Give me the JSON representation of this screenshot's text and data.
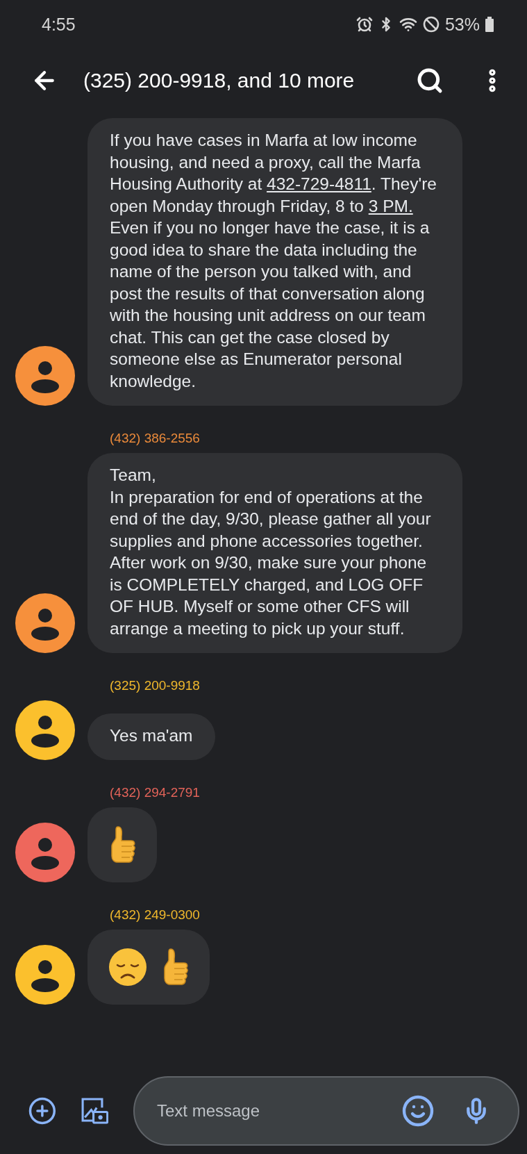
{
  "status_bar": {
    "time": "4:55",
    "battery": "53%"
  },
  "header": {
    "title": "(325) 200-9918, and 10 more"
  },
  "messages": [
    {
      "kind": "text",
      "color": "#f6903c",
      "parts": [
        {
          "text": "If you have cases in Marfa at low income housing, and need a proxy, call the Marfa Housing Authority at ",
          "link": false
        },
        {
          "text": "432-729-4811",
          "link": true
        },
        {
          "text": ". They're open Monday through Friday, 8 to ",
          "link": false
        },
        {
          "text": "3 PM.",
          "link": true
        },
        {
          "text": " Even if you no longer have the case, it is a good idea to share the data including the name of the person you talked with, and post the results of that conversation along with the housing unit address on our team chat. This can get the case closed by someone else as Enumerator personal knowledge.",
          "link": false
        }
      ]
    },
    {
      "kind": "text",
      "sender": "(432) 386-2556",
      "color": "#f6903c",
      "parts": [
        {
          "text": "Team,\nIn preparation for end of operations at the end of the day, 9/30, please gather all your supplies and phone accessories together. After work on 9/30, make sure your phone is COMPLETELY charged, and LOG OFF OF HUB. Myself or some other CFS will arrange a meeting to pick up your stuff.",
          "link": false
        }
      ]
    },
    {
      "kind": "text",
      "sender": "(325) 200-9918",
      "color": "#fbc02d",
      "parts": [
        {
          "text": "Yes ma'am",
          "link": false
        }
      ]
    },
    {
      "kind": "emoji",
      "sender": "(432) 294-2791",
      "color": "#ee675c",
      "emojis": [
        {
          "kind": "thumbs_up"
        }
      ]
    },
    {
      "kind": "emoji",
      "sender": "(432) 249-0300",
      "color": "#fbc02d",
      "emojis": [
        {
          "kind": "sad_face"
        },
        {
          "kind": "thumbs_up"
        }
      ]
    }
  ],
  "composer": {
    "placeholder": "Text message"
  }
}
